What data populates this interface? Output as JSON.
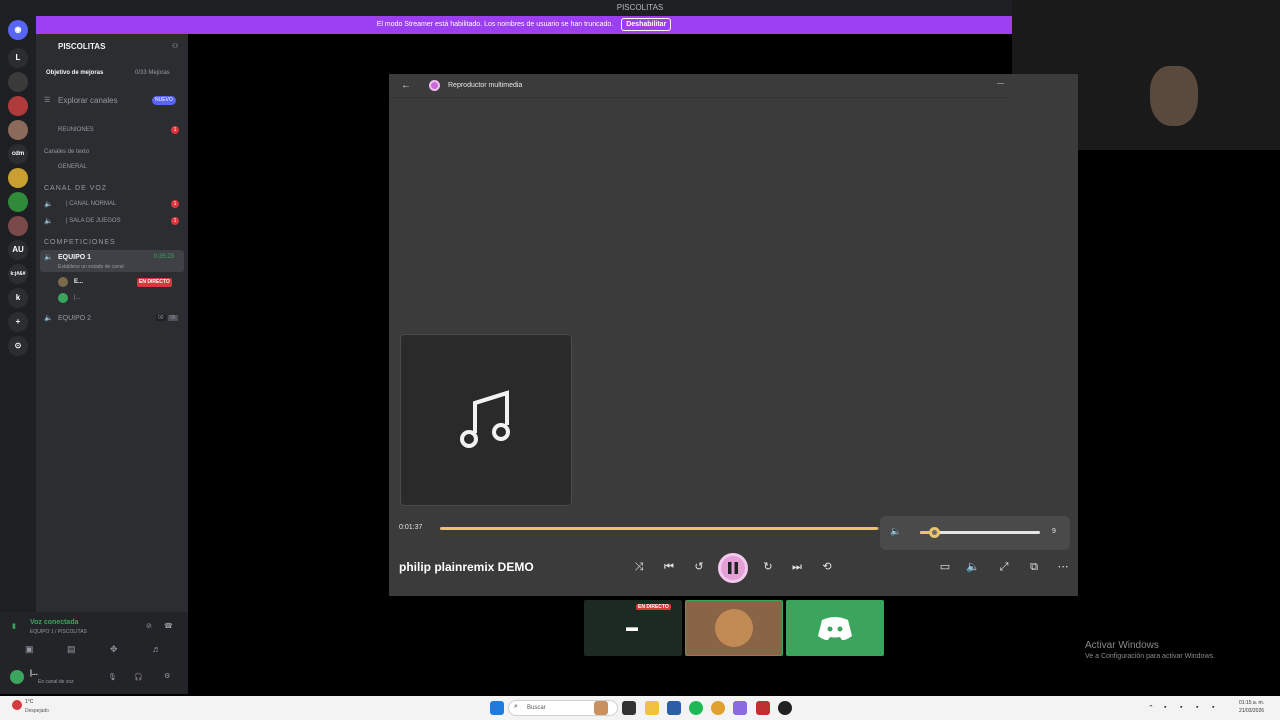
{
  "window": {
    "title": "PISCOLITAS"
  },
  "banner": {
    "text": "El modo Streamer está habilitado. Los nombres de usuario se han truncado.",
    "button": "Deshabilitar"
  },
  "rail": {
    "items": [
      "L",
      "cdm",
      "AU",
      "k:j#&#",
      "k"
    ]
  },
  "sidebar": {
    "server_name": "PISCOLITAS",
    "goal_label": "Objetivo de mejoras",
    "goal_count": "0/33 Mejoras",
    "explore": "Explorar canales",
    "new_badge": "NUEVO",
    "reuniones": "REUNIONES",
    "text_cat": "Canales de texto",
    "general": "GENERAL",
    "voice_cat": "CANAL DE VOZ",
    "canal_normal": "| CANAL NORMAL",
    "sala_juegos": "| SALA DE JUEGOS",
    "comp_cat": "COMPETICIONES",
    "equipo1": "EQUIPO 1",
    "equipo1_time": "0:35:23",
    "equipo1_status": "Establece un estado de canal",
    "user1": "E...",
    "user2": "|...",
    "live_badge": "EN DIRECTO",
    "equipo2": "EQUIPO 2",
    "equipo2_count1": "00",
    "equipo2_count2": "05",
    "badge_count": "1"
  },
  "voice": {
    "status": "Voz conectada",
    "channel": "EQUIPO 1 / PISCOLITAS",
    "user": "|...",
    "user_status": "En canal de voz"
  },
  "player": {
    "title": "Reproductor multimedia",
    "elapsed": "0:01:37",
    "progress": 0.995,
    "track": "philip plainremix DEMO",
    "volume": 9,
    "volume_fraction": 0.12
  },
  "thumbs": {
    "live": "EN DIRECTO"
  },
  "activate": {
    "title": "Activar Windows",
    "subtitle": "Ve a Configuración para activar Windows."
  },
  "taskbar": {
    "weather_temp": "1°C",
    "weather_desc": "Despejado",
    "search": "Buscar",
    "time": "01:15 a. m.",
    "date": "21/03/2026"
  },
  "colors": {
    "accent": "#e9c46a",
    "banner": "#9b3ff0",
    "discord_green": "#3ba55d"
  }
}
